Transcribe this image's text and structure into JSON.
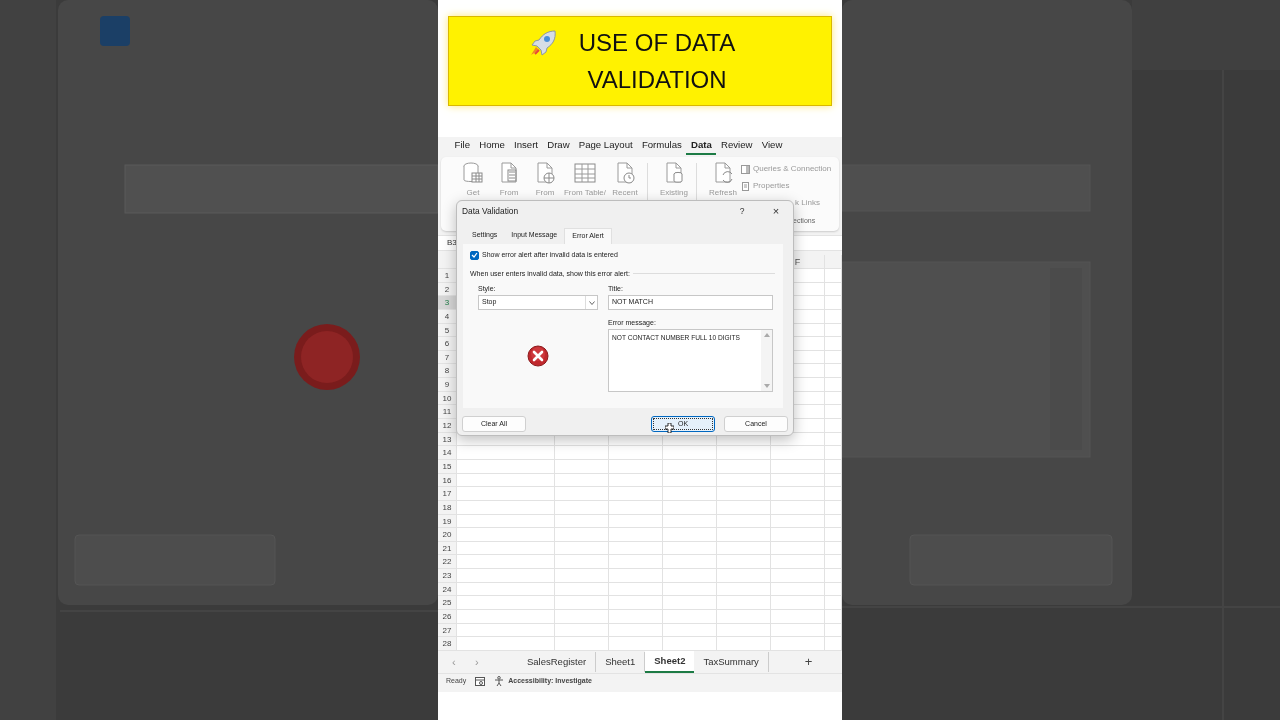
{
  "backdrop": {
    "kind": "picture"
  },
  "banner": {
    "title": "USE OF DATA VALIDATION"
  },
  "menu": [
    {
      "label": "File",
      "selected": false
    },
    {
      "label": "Home",
      "selected": false
    },
    {
      "label": "Insert",
      "selected": false
    },
    {
      "label": "Draw",
      "selected": false
    },
    {
      "label": "Page Layout",
      "selected": false
    },
    {
      "label": "Formulas",
      "selected": false
    },
    {
      "label": "Data",
      "selected": true
    },
    {
      "label": "Review",
      "selected": false
    },
    {
      "label": "View",
      "selected": false
    }
  ],
  "ribbon": {
    "buttons": [
      {
        "label": "Get",
        "kind": "database"
      },
      {
        "label": "From",
        "kind": "text"
      },
      {
        "label": "From",
        "kind": "web"
      },
      {
        "label": "From Table/",
        "kind": "table"
      },
      {
        "label": "Recent",
        "kind": "recent"
      },
      {
        "label": "Existing",
        "kind": "existing"
      },
      {
        "label": "Refresh",
        "kind": "refresh"
      }
    ],
    "side_items": [
      {
        "label": "Queries & Connection",
        "kind": "queries"
      },
      {
        "label": "Properties",
        "kind": "properties"
      },
      {
        "label": "k Links",
        "kind": "links"
      }
    ],
    "group_label": "ections"
  },
  "name_box": "B3",
  "column_header": "F",
  "rows": [
    {
      "label": "1",
      "selected": false
    },
    {
      "label": "2",
      "selected": false
    },
    {
      "label": "3",
      "selected": true
    },
    {
      "label": "4",
      "selected": false
    },
    {
      "label": "5",
      "selected": false
    },
    {
      "label": "6",
      "selected": false
    },
    {
      "label": "7",
      "selected": false
    },
    {
      "label": "8",
      "selected": false
    },
    {
      "label": "9",
      "selected": false
    },
    {
      "label": "10",
      "selected": false
    },
    {
      "label": "11",
      "selected": false
    },
    {
      "label": "12",
      "selected": false
    },
    {
      "label": "13",
      "selected": false
    },
    {
      "label": "14",
      "selected": false
    },
    {
      "label": "15",
      "selected": false
    },
    {
      "label": "16",
      "selected": false
    },
    {
      "label": "17",
      "selected": false
    },
    {
      "label": "18",
      "selected": false
    },
    {
      "label": "19",
      "selected": false
    },
    {
      "label": "20",
      "selected": false
    },
    {
      "label": "21",
      "selected": false
    },
    {
      "label": "22",
      "selected": false
    },
    {
      "label": "23",
      "selected": false
    },
    {
      "label": "24",
      "selected": false
    },
    {
      "label": "25",
      "selected": false
    },
    {
      "label": "26",
      "selected": false
    },
    {
      "label": "27",
      "selected": false
    },
    {
      "label": "28",
      "selected": false
    }
  ],
  "dialog": {
    "title": "Data Validation",
    "help": "?",
    "close": "×",
    "tabs": [
      {
        "label": "Settings",
        "selected": false
      },
      {
        "label": "Input Message",
        "selected": false
      },
      {
        "label": "Error Alert",
        "selected": true
      }
    ],
    "show_alert": {
      "label": "Show error alert after invalid data is entered",
      "checked": true
    },
    "section_label": "When user enters invalid data, show this error alert:",
    "style": {
      "label": "Style:",
      "value": "Stop"
    },
    "title_field": {
      "label": "Title:",
      "value": "NOT MATCH"
    },
    "message": {
      "label": "Error message:",
      "value": "NOT CONTACT NUMBER FULL 10 DIGITS"
    },
    "buttons": [
      {
        "label": "Clear All",
        "default": false
      },
      {
        "label": "OK",
        "default": true
      },
      {
        "label": "Cancel",
        "default": false
      }
    ]
  },
  "sheet_tabs": [
    {
      "label": "SalesRegister",
      "selected": false
    },
    {
      "label": "Sheet1",
      "selected": false
    },
    {
      "label": "Sheet2",
      "selected": true
    },
    {
      "label": "TaxSummary",
      "selected": false
    }
  ],
  "sheet_nav": [
    "‹",
    "›"
  ],
  "add_sheet": "+",
  "status_bar": {
    "ready": "Ready",
    "accessibility": "Accessibility: Investigate"
  }
}
